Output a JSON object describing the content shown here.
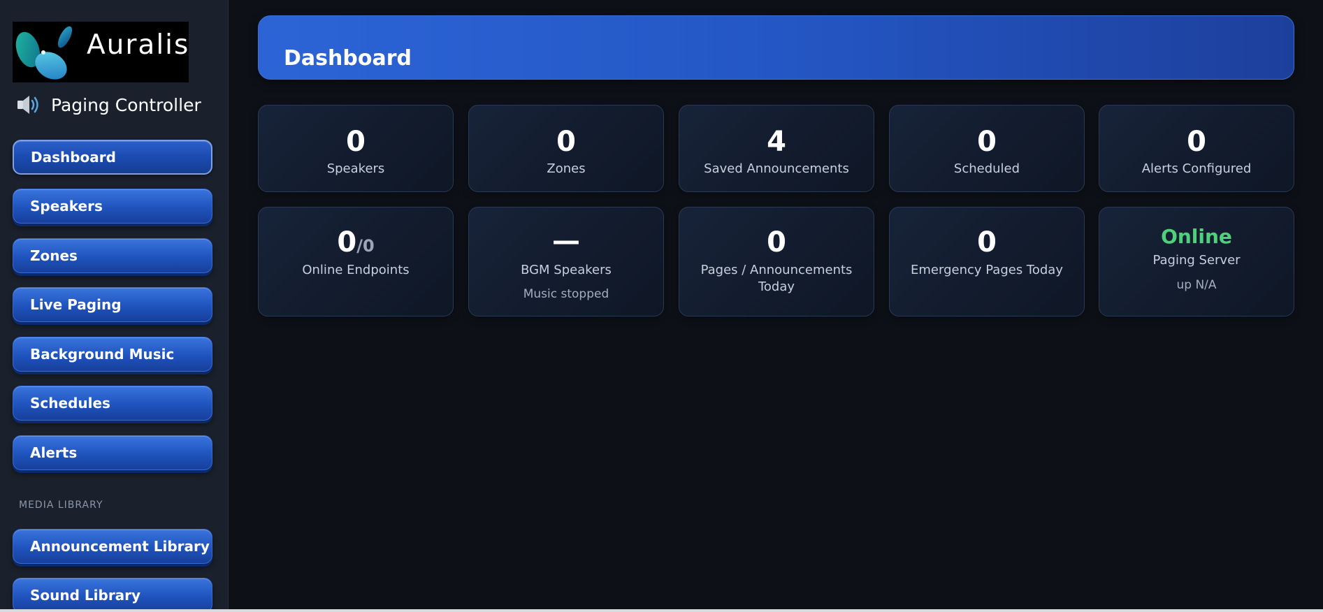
{
  "brand": {
    "logo_text": "Auralis",
    "app_title": "Paging Controller"
  },
  "sidebar": {
    "items": [
      {
        "label": "Dashboard",
        "active": true
      },
      {
        "label": "Speakers"
      },
      {
        "label": "Zones"
      },
      {
        "label": "Live Paging"
      },
      {
        "label": "Background Music"
      },
      {
        "label": "Schedules"
      },
      {
        "label": "Alerts"
      }
    ],
    "section_media_library": "MEDIA LIBRARY",
    "media_items": [
      {
        "label": "Announcement Library"
      },
      {
        "label": "Sound Library"
      }
    ]
  },
  "header": {
    "title": "Dashboard"
  },
  "stats_row1": [
    {
      "value": "0",
      "label": "Speakers"
    },
    {
      "value": "0",
      "label": "Zones"
    },
    {
      "value": "4",
      "label": "Saved Announcements"
    },
    {
      "value": "0",
      "label": "Scheduled"
    },
    {
      "value": "0",
      "label": "Alerts Configured"
    }
  ],
  "stats_row2": {
    "online_endpoints": {
      "value": "0",
      "total": "/0",
      "label": "Online Endpoints"
    },
    "bgm_speakers": {
      "value": "—",
      "label": "BGM Speakers",
      "sub": "Music stopped"
    },
    "pages_today": {
      "value": "0",
      "label": "Pages / Announcements Today"
    },
    "emergency_today": {
      "value": "0",
      "label": "Emergency Pages Today"
    },
    "paging_server": {
      "status": "Online",
      "label": "Paging Server",
      "sub": "up N/A"
    }
  },
  "colors": {
    "accent_blue": "#2457c5",
    "online_green": "#4ed17a",
    "background": "#0d1117",
    "sidebar_bg": "#1a212c"
  }
}
